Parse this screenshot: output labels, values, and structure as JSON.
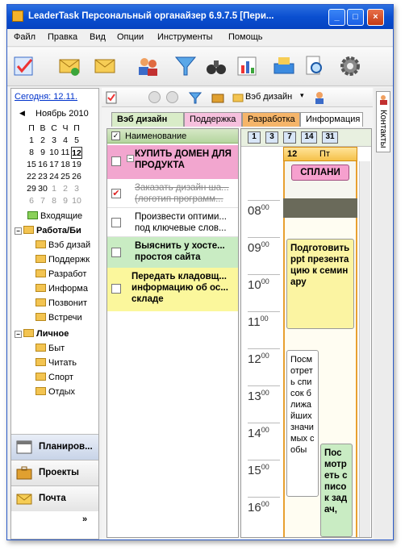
{
  "window": {
    "title": "LeaderTask Персональный органайзер 6.9.7.5 [Пери...",
    "controls": [
      "_",
      "□",
      "×"
    ]
  },
  "menu": [
    "Файл",
    "Правка",
    "Вид",
    "Опции",
    "Инструменты",
    "Помощь"
  ],
  "toolbar_icons": [
    "checklist-icon",
    "email-add-icon",
    "email-icon",
    "people-icon",
    "filter-icon",
    "binoculars-icon",
    "chart-icon",
    "printer-icon",
    "preview-icon",
    "gear-icon"
  ],
  "sidebar": {
    "today_link": "Сегодня: 12.11.",
    "calendar": {
      "month": "Ноябрь 2010",
      "weekdays": [
        "П",
        "В",
        "С",
        "Ч",
        "П"
      ],
      "weeks": [
        [
          "1",
          "2",
          "3",
          "4",
          "5"
        ],
        [
          "8",
          "9",
          "10",
          "11",
          "12"
        ],
        [
          "15",
          "16",
          "17",
          "18",
          "19"
        ],
        [
          "22",
          "23",
          "24",
          "25",
          "26"
        ],
        [
          "29",
          "30",
          "1",
          "2",
          "3"
        ],
        [
          "6",
          "7",
          "8",
          "9",
          "10"
        ]
      ],
      "selected": "12"
    },
    "tree": {
      "inbox": "Входящие",
      "work": "Работа/Би",
      "work_items": [
        "Вэб дизай",
        "Поддержк",
        "Разработ",
        "Информа",
        "Позвонит",
        "Встречи"
      ],
      "personal": "Личное",
      "personal_items": [
        "Быт",
        "Читать",
        "Спорт",
        "Отдых"
      ]
    },
    "nav": {
      "planner": "Планиров...",
      "projects": "Проекты",
      "mail": "Почта",
      "more": "»"
    }
  },
  "subtoolbar": {
    "project_label": "Вэб дизайн"
  },
  "tabs": [
    "Вэб дизайн",
    "Поддержка",
    "Разработка",
    "Информация"
  ],
  "tasks": {
    "header": "Наименование",
    "items": [
      {
        "text": "КУПИТЬ ДОМЕН ДЛЯ ПРОДУКТА",
        "checked": false,
        "bg": "#f2a6cf"
      },
      {
        "text": "Заказать дизайн ша... (логотип программ...",
        "checked": true,
        "bg": "#ffffff"
      },
      {
        "text": "Произвести оптими... под ключевые слов...",
        "checked": false,
        "bg": "#ffffff"
      },
      {
        "text": "Выяснить у хосте... простоя сайта",
        "checked": false,
        "bg": "#c9ecc3"
      },
      {
        "text": "Передать кладовщ... информацию об ос... складе",
        "checked": false,
        "bg": "#fbf79c"
      }
    ]
  },
  "planner": {
    "view_buttons": [
      "1",
      "3",
      "7",
      "14",
      "31"
    ],
    "day": {
      "number": "12",
      "weekday": "Пт"
    },
    "all_day_event": "СПЛАНИ",
    "hours": [
      "08",
      "09",
      "10",
      "11",
      "12",
      "13",
      "14",
      "15",
      "16"
    ],
    "minutes": "00",
    "appointments": [
      {
        "text": "Подготовить ppt презентацию к семинару",
        "bg": "#fbf4a2"
      },
      {
        "text": "Посмотреть список ближайших значимых собы",
        "bg": "#ffffff"
      },
      {
        "text": "Посмотреть список задач,",
        "bg": "#c9ecc3"
      }
    ]
  },
  "right_tab": "Контакты"
}
